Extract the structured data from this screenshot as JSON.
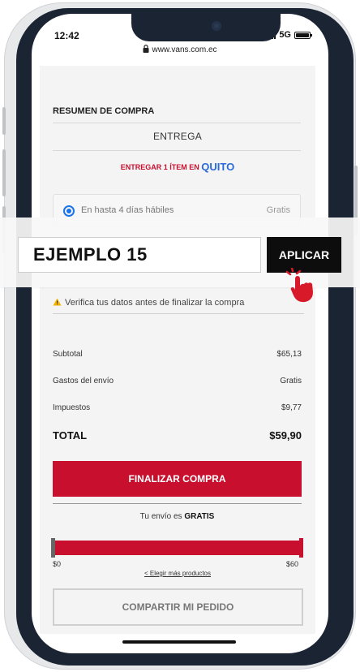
{
  "status": {
    "time": "12:42",
    "network": "5G"
  },
  "browser": {
    "url": "www.vans.com.ec"
  },
  "summary": {
    "title": "RESUMEN DE COMPRA",
    "section": "ENTREGA",
    "deliver_prefix": "ENTREGAR 1 ÍTEM EN",
    "deliver_city": "QUITO",
    "option": {
      "label": "En hasta 4 días hábiles",
      "price": "Gratis",
      "selected": true
    }
  },
  "coupon": {
    "code": "EJEMPLO 15",
    "apply_label": "APLICAR"
  },
  "warning": "Verifica tus datos antes de finalizar la compra",
  "totals": {
    "subtotal_label": "Subtotal",
    "subtotal": "$65,13",
    "shipping_label": "Gastos del envío",
    "shipping": "Gratis",
    "tax_label": "Impuestos",
    "tax": "$9,77",
    "total_label": "TOTAL",
    "total": "$59,90"
  },
  "finalize_label": "FINALIZAR COMPRA",
  "shipping_note": {
    "prefix": "Tu envío es",
    "emphasis": "GRATIS"
  },
  "progress": {
    "min": "$0",
    "max": "$60",
    "fraction": 1.0
  },
  "more_products": "< Elegir más productos",
  "share_label": "COMPARTIR MI PEDIDO",
  "colors": {
    "brand_red": "#c8102e",
    "city_blue": "#2a6ad8",
    "apply_black": "#0d0d0d"
  }
}
